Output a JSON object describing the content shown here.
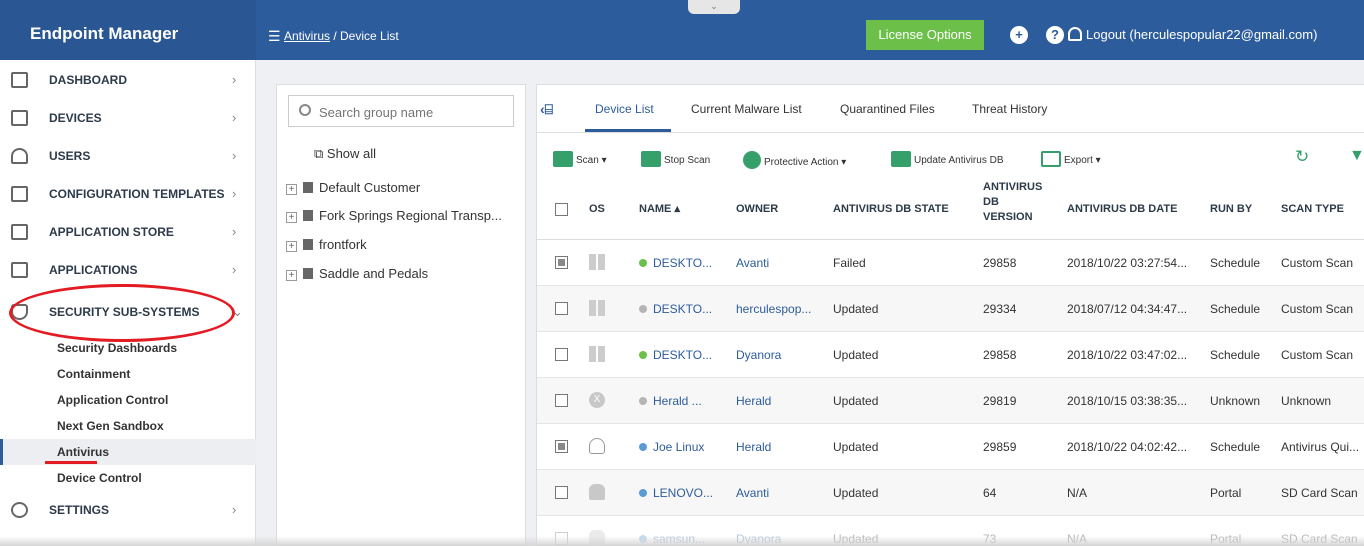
{
  "app": {
    "brand": "Endpoint Manager"
  },
  "header": {
    "breadcrumb_link": "Antivirus",
    "breadcrumb_rest": " / Device List",
    "license_button": "License Options",
    "logout": "Logout (herculespopular22@gmail.com)"
  },
  "nav": {
    "items": [
      {
        "label": "DASHBOARD"
      },
      {
        "label": "DEVICES"
      },
      {
        "label": "USERS"
      },
      {
        "label": "CONFIGURATION TEMPLATES"
      },
      {
        "label": "APPLICATION STORE"
      },
      {
        "label": "APPLICATIONS"
      },
      {
        "label": "SECURITY SUB-SYSTEMS"
      },
      {
        "label": "SETTINGS"
      }
    ],
    "sub_items": [
      {
        "label": "Security Dashboards"
      },
      {
        "label": "Containment"
      },
      {
        "label": "Application Control"
      },
      {
        "label": "Next Gen Sandbox"
      },
      {
        "label": "Antivirus"
      },
      {
        "label": "Device Control"
      }
    ]
  },
  "groups": {
    "search_placeholder": "Search group name",
    "show_all": "Show all",
    "items": [
      {
        "label": "Default Customer"
      },
      {
        "label": "Fork Springs Regional Transp..."
      },
      {
        "label": "frontfork"
      },
      {
        "label": "Saddle and Pedals"
      }
    ]
  },
  "tabs": [
    {
      "label": "Device List"
    },
    {
      "label": "Current Malware List"
    },
    {
      "label": "Quarantined Files"
    },
    {
      "label": "Threat History"
    }
  ],
  "toolbar": {
    "scan": "Scan ▾",
    "stop_scan": "Stop Scan",
    "protective_action": "Protective Action ▾",
    "update_db": "Update Antivirus DB",
    "export": "Export ▾"
  },
  "table": {
    "columns": {
      "os": "OS",
      "name": "NAME ▴",
      "owner": "OWNER",
      "db_state": "ANTIVIRUS DB STATE",
      "db_version_1": "ANTIVIRUS",
      "db_version_2": "DB",
      "db_version_3": "VERSION",
      "db_date": "ANTIVIRUS DB DATE",
      "run_by": "RUN BY",
      "scan_type": "SCAN TYPE"
    },
    "rows": [
      {
        "os": "windows",
        "status_color": "#6cc04a",
        "name": "DESKTO...",
        "owner": "Avanti",
        "db_state": "Failed",
        "db_version": "29858",
        "db_date": "2018/10/22 03:27:54...",
        "run_by": "Schedule",
        "scan_type": "Custom Scan",
        "checked": true
      },
      {
        "os": "windows",
        "status_color": "#b5b5b5",
        "name": "DESKTO...",
        "owner": "herculespop...",
        "db_state": "Updated",
        "db_version": "29334",
        "db_date": "2018/07/12 04:34:47...",
        "run_by": "Schedule",
        "scan_type": "Custom Scan",
        "checked": false
      },
      {
        "os": "windows",
        "status_color": "#6cc04a",
        "name": "DESKTO...",
        "owner": "Dyanora",
        "db_state": "Updated",
        "db_version": "29858",
        "db_date": "2018/10/22 03:47:02...",
        "run_by": "Schedule",
        "scan_type": "Custom Scan",
        "checked": false
      },
      {
        "os": "mac",
        "status_color": "#b5b5b5",
        "name": "Herald ...",
        "owner": "Herald",
        "db_state": "Updated",
        "db_version": "29819",
        "db_date": "2018/10/15 03:38:35...",
        "run_by": "Unknown",
        "scan_type": "Unknown",
        "checked": false
      },
      {
        "os": "linux",
        "status_color": "#5a9bd5",
        "name": "Joe Linux",
        "owner": "Herald",
        "db_state": "Updated",
        "db_version": "29859",
        "db_date": "2018/10/22 04:02:42...",
        "run_by": "Schedule",
        "scan_type": "Antivirus Qui...",
        "checked": true
      },
      {
        "os": "android",
        "status_color": "#5a9bd5",
        "name": "LENOVO...",
        "owner": "Avanti",
        "db_state": "Updated",
        "db_version": "64",
        "db_date": "N/A",
        "run_by": "Portal",
        "scan_type": "SD Card Scan",
        "checked": false
      },
      {
        "os": "android",
        "status_color": "#5a9bd5",
        "name": "samsun...",
        "owner": "Dyanora",
        "db_state": "Updated",
        "db_version": "73",
        "db_date": "N/A",
        "run_by": "Portal",
        "scan_type": "SD Card Scan",
        "checked": false
      }
    ]
  },
  "colors": {
    "header": "#2d5c9c",
    "accent_green": "#6cc04a",
    "annotation_red": "#e31b23"
  }
}
